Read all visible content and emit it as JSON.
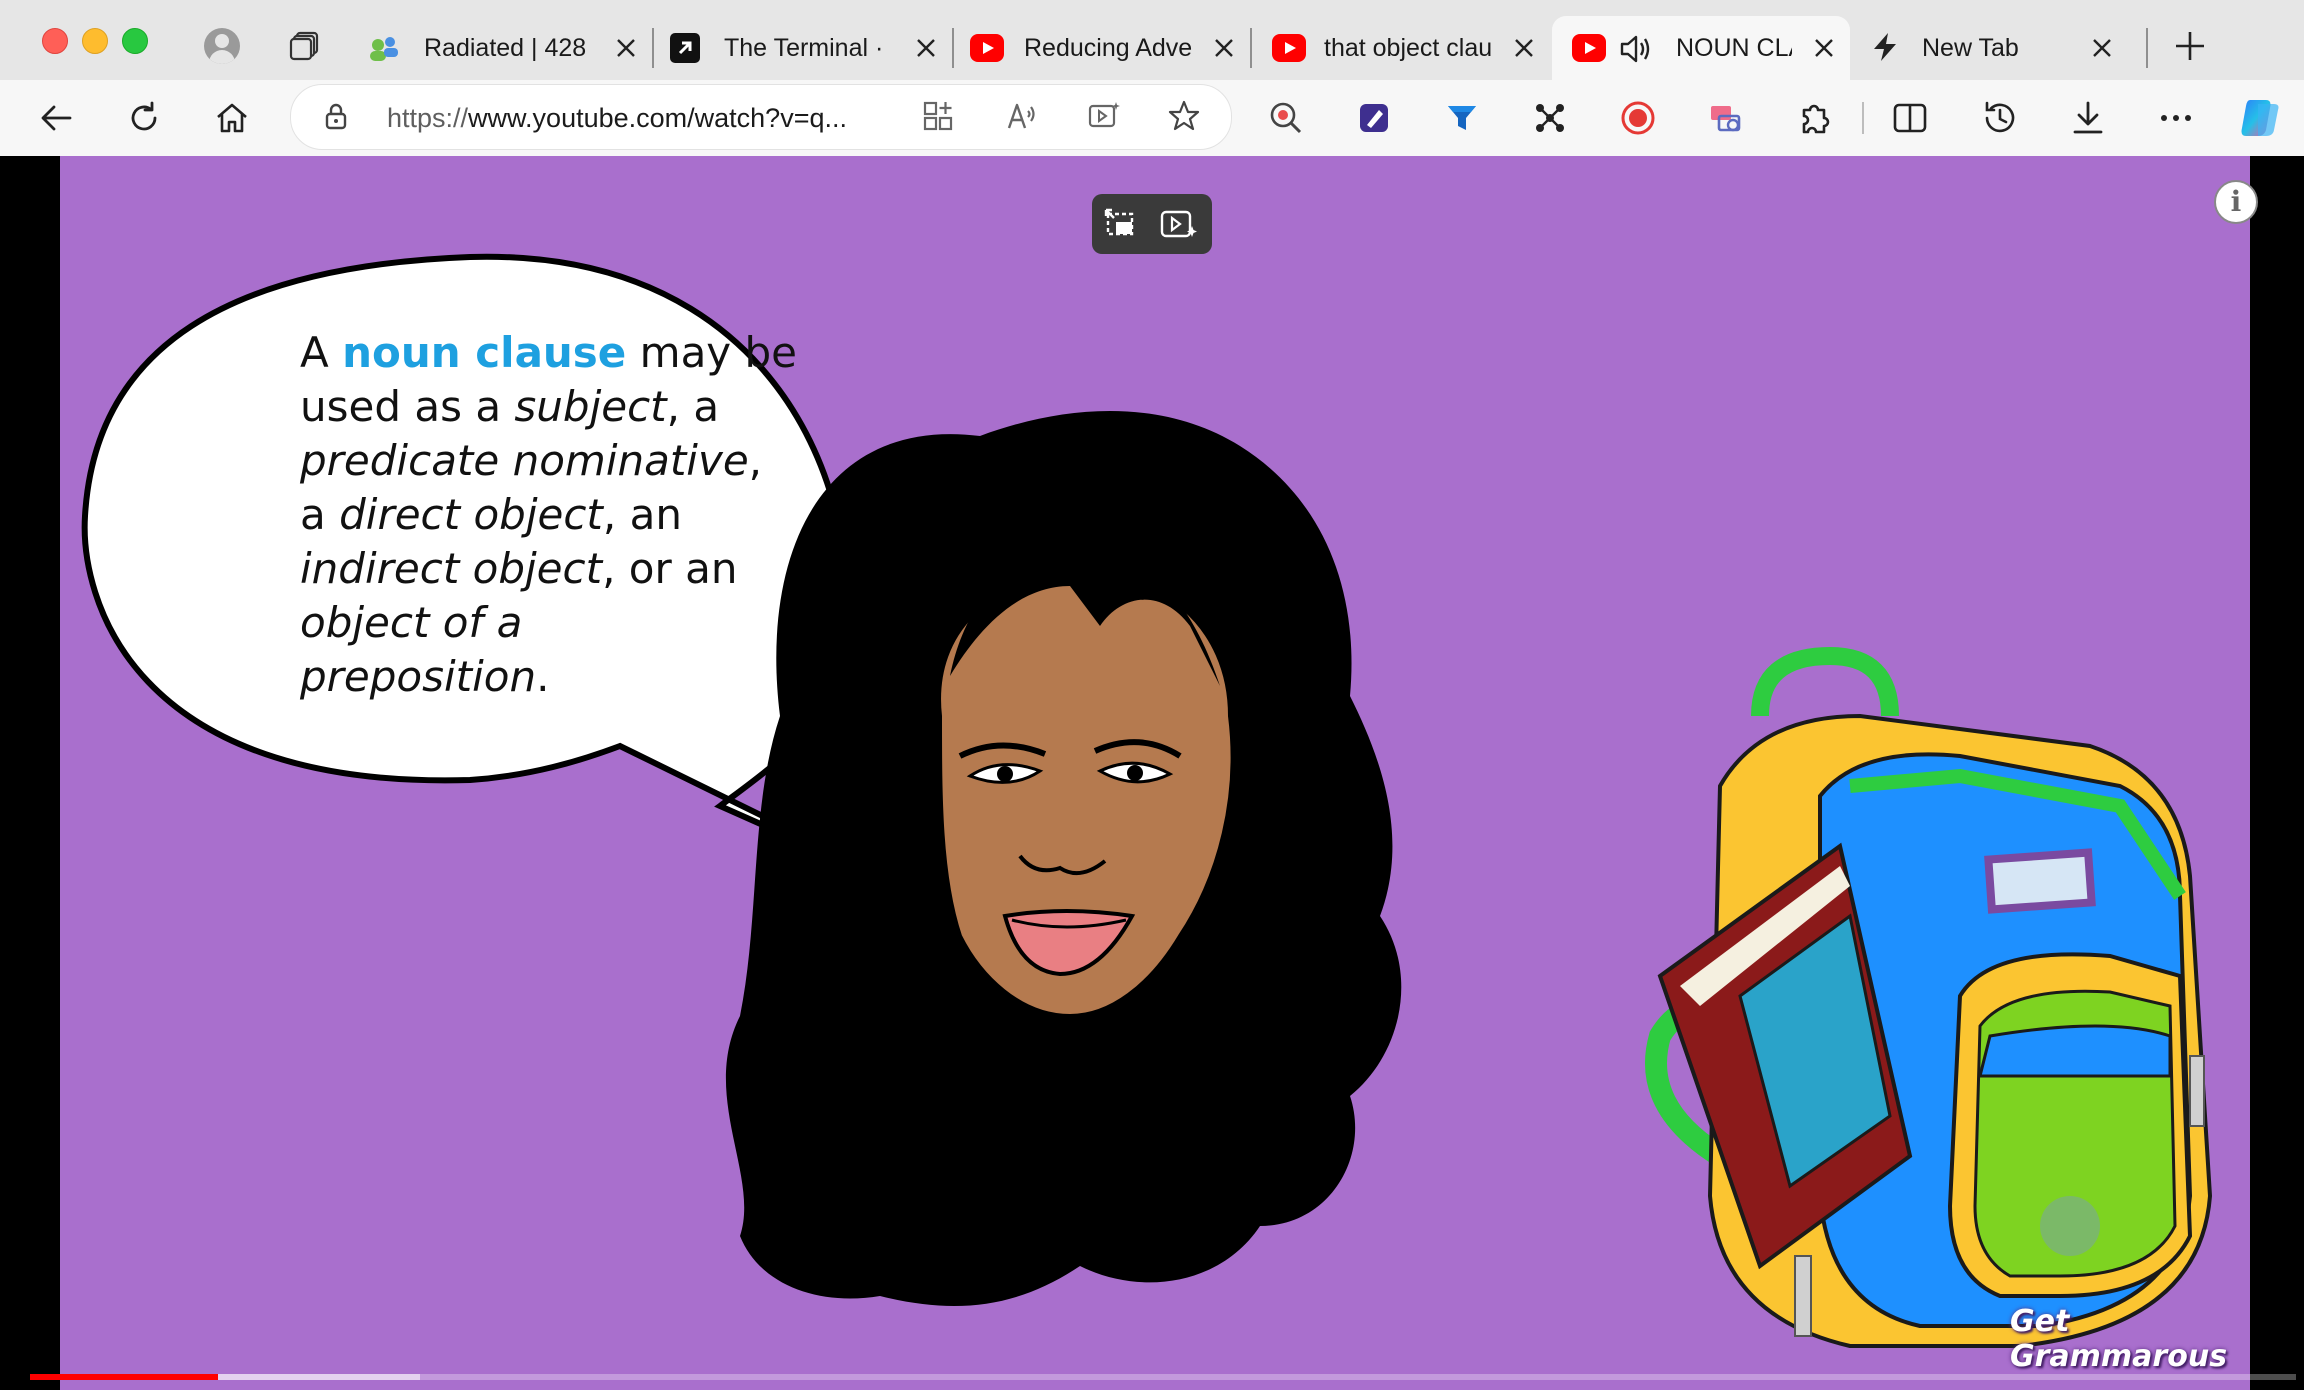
{
  "tabs": [
    {
      "label": "Radiated | 428",
      "favicon": "user-group-icon"
    },
    {
      "label": "The Terminal ·",
      "favicon": "terminal-arrow-icon"
    },
    {
      "label": "Reducing Adve",
      "favicon": "youtube-icon"
    },
    {
      "label": "that object clau",
      "favicon": "youtube-icon"
    },
    {
      "label": "NOUN CLA",
      "favicon": "youtube-icon",
      "active": true,
      "audio": true
    },
    {
      "label": "New Tab",
      "favicon": "lightning-icon"
    }
  ],
  "address": {
    "scheme": "https://",
    "host_path": "www.youtube.com/watch?v=q..."
  },
  "video": {
    "bubble": {
      "word1": "A",
      "highlight": "noun clause",
      "l1_rest": "may be",
      "l2a": "used as a",
      "l2b": "subject",
      "l2c": ", a",
      "l3a": "predicate nominative",
      "l3b": ",",
      "l4a": "a",
      "l4b": "direct object",
      "l4c": ", an",
      "l5a": "indirect object",
      "l5b": ", or an",
      "l6a": "object of a",
      "l7a": "preposition",
      "l7b": "."
    },
    "brand": "Get Grammarous",
    "progress_played": 0.083,
    "progress_buffered": 0.172
  },
  "colors": {
    "stage": "#a96fcd",
    "highlight": "#1ea0e0",
    "progress": "#ff0000"
  }
}
